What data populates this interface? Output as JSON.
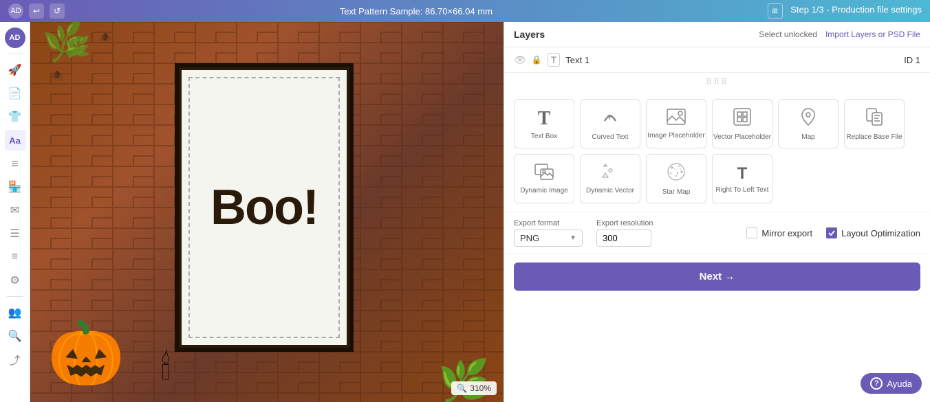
{
  "topbar": {
    "title": "Text Pattern Sample: 86.70×66.04 mm",
    "step": "Step 1/3 - Production file settings",
    "refresh_icon": "↺",
    "undo_icon": "↩",
    "layout_icon": "⊞"
  },
  "sidebar": {
    "avatar": "AD",
    "items": [
      {
        "label": "rocket-icon",
        "icon": "🚀"
      },
      {
        "label": "file-icon",
        "icon": "📄"
      },
      {
        "label": "tshirt-icon",
        "icon": "👕"
      },
      {
        "label": "text-tool-icon",
        "icon": "Aa"
      },
      {
        "label": "layers-icon",
        "icon": "≡"
      },
      {
        "label": "store-icon",
        "icon": "🏪"
      },
      {
        "label": "mail-icon",
        "icon": "✉"
      },
      {
        "label": "list-icon",
        "icon": "☰"
      },
      {
        "label": "list2-icon",
        "icon": "≡"
      },
      {
        "label": "settings-icon",
        "icon": "⚙"
      },
      {
        "label": "people-icon",
        "icon": "👥"
      },
      {
        "label": "search-icon",
        "icon": "🔍"
      },
      {
        "label": "share-icon",
        "icon": "⤴"
      }
    ]
  },
  "canvas": {
    "zoom_label": "310%",
    "zoom_icon": "🔍"
  },
  "layers": {
    "title": "Layers",
    "select_unlocked": "Select unlocked",
    "import_button": "Import Layers or PSD File",
    "layer_name": "Text 1",
    "layer_id": "ID 1"
  },
  "tools": [
    {
      "id": "text-box",
      "icon": "T",
      "icon_type": "bold",
      "label": "Text Box"
    },
    {
      "id": "curved-text",
      "icon": "T̃",
      "icon_type": "curved",
      "label": "Curved Text"
    },
    {
      "id": "image-placeholder",
      "icon": "🖼",
      "icon_type": "image",
      "label": "Image Placeholder"
    },
    {
      "id": "vector-placeholder",
      "icon": "⊞",
      "icon_type": "vector",
      "label": "Vector Placeholder"
    },
    {
      "id": "map",
      "icon": "📍",
      "icon_type": "map",
      "label": "Map"
    },
    {
      "id": "replace-base-file",
      "icon": "📋",
      "icon_type": "replace",
      "label": "Replace Base File"
    },
    {
      "id": "dynamic-image",
      "icon": "🖼",
      "icon_type": "dynamic",
      "label": "Dynamic Image"
    },
    {
      "id": "dynamic-vector",
      "icon": "★♡△",
      "icon_type": "shapes",
      "label": "Dynamic Vector"
    },
    {
      "id": "star-map",
      "icon": "✦",
      "icon_type": "star",
      "label": "Star Map"
    },
    {
      "id": "right-to-left",
      "icon": "T",
      "icon_type": "rtl",
      "label": "Right To Left Text"
    }
  ],
  "export": {
    "format_label": "Export format",
    "format_value": "PNG",
    "resolution_label": "Export resolution",
    "resolution_value": "300",
    "mirror_label": "Mirror export",
    "layout_label": "Layout Optimization"
  },
  "next_button": "Next →",
  "help": {
    "label": "Ayuda",
    "icon": "?"
  }
}
